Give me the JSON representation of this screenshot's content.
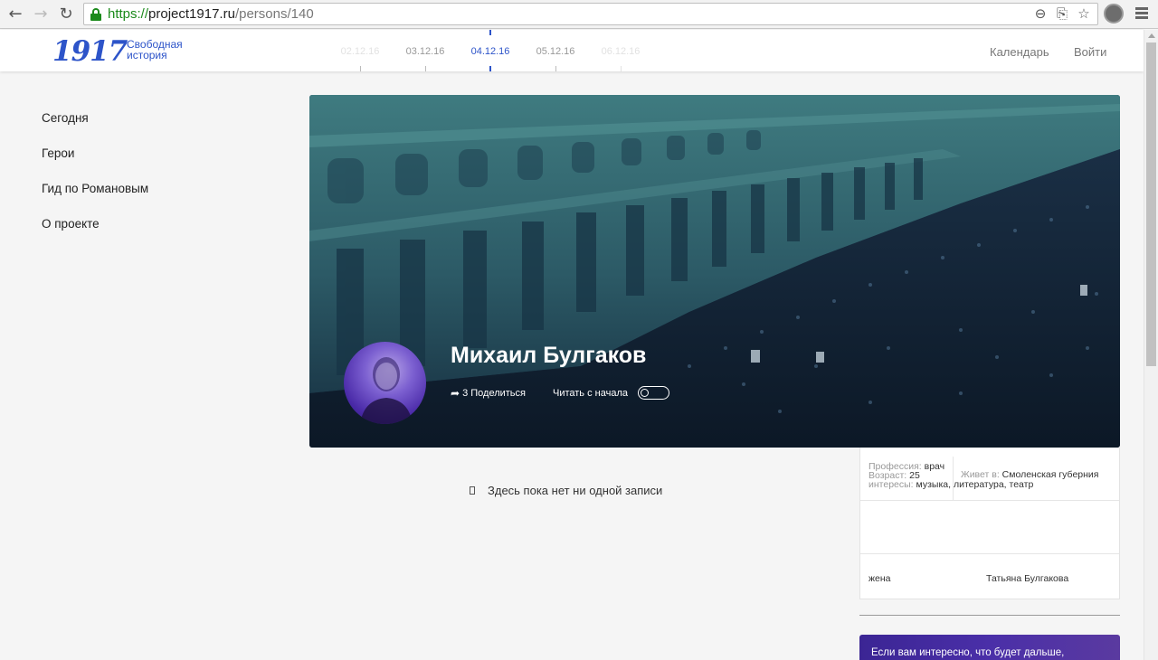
{
  "browser": {
    "url_scheme": "https://",
    "url_host": "project1917.ru",
    "url_path": "/persons/140",
    "icons": [
      "back-icon",
      "forward-icon",
      "reload-icon",
      "lock-icon",
      "zoom-icon",
      "translate-icon",
      "star-icon",
      "extension-icon",
      "menu-icon"
    ]
  },
  "header": {
    "logo_number": "1917",
    "logo_line1": "Свободная",
    "logo_line2": "история",
    "timeline": [
      "02.12.16",
      "03.12.16",
      "04.12.16",
      "05.12.16",
      "06.12.16"
    ],
    "timeline_active": "04.12.16",
    "calendar_label": "Календарь",
    "login_label": "Войти",
    "accent_color": "#2d54c9"
  },
  "sidebar": {
    "items": [
      {
        "label": "Сегодня"
      },
      {
        "label": "Герои"
      },
      {
        "label": "Гид по Романовым"
      },
      {
        "label": "О проекте"
      }
    ]
  },
  "hero": {
    "name": "Михаил Булгаков",
    "share_count": "3",
    "share_label": "Поделиться",
    "read_label": "Читать с начала",
    "toggle_on": false
  },
  "feed": {
    "empty_text": "Здесь пока нет ни одной записи"
  },
  "info": {
    "age_label": "Возраст:",
    "age_value": "25",
    "lives_label": "Живет в:",
    "lives_value": "Смоленская губерния",
    "profession_label": "Профессия:",
    "profession_value": "врач",
    "interests_label": "интересы:",
    "interests_value": "музыка, литература, театр",
    "relation_label": "жена",
    "relation_name": "Татьяна Булгакова"
  },
  "promo": {
    "text": "Если вам интересно, что будет дальше,"
  }
}
